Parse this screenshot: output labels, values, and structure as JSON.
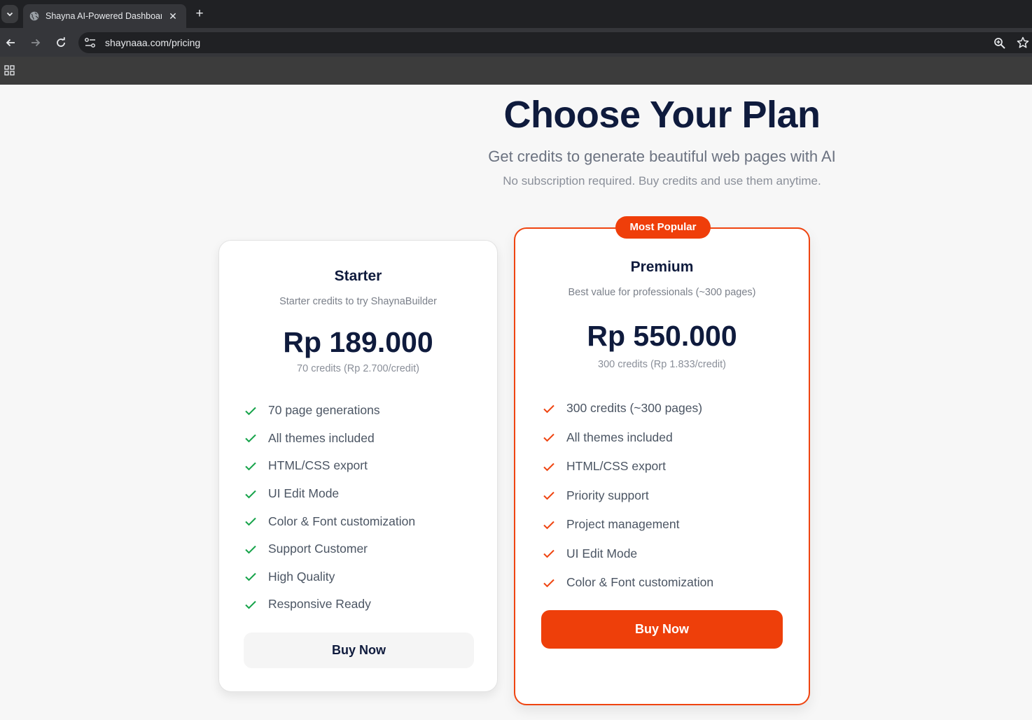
{
  "browser": {
    "tab_title": "Shayna AI-Powered Dashboard",
    "url": "shaynaaa.com/pricing",
    "icons": [
      "chevron-down-icon",
      "globe-icon",
      "close-icon",
      "plus-icon",
      "back-arrow-icon",
      "forward-arrow-icon",
      "reload-icon",
      "site-info-icon",
      "zoom-icon",
      "star-icon",
      "apps-icon"
    ]
  },
  "hero": {
    "title": "Choose Your Plan",
    "subtitle": "Get credits to generate beautiful web pages with AI",
    "note": "No subscription required. Buy credits and use them anytime."
  },
  "plans": [
    {
      "name": "Starter",
      "description": "Starter credits to try ShaynaBuilder",
      "price": "Rp 189.000",
      "unit": "70 credits (Rp 2.700/credit)",
      "features": [
        "70 page generations",
        "All themes included",
        "HTML/CSS export",
        "UI Edit Mode",
        "Color & Font customization",
        "Support Customer",
        "High Quality",
        "Responsive Ready"
      ],
      "button": "Buy Now",
      "check_color": "#16a34a"
    },
    {
      "badge": "Most Popular",
      "name": "Premium",
      "description": "Best value for professionals (~300 pages)",
      "price": "Rp 550.000",
      "unit": "300 credits (Rp 1.833/credit)",
      "features": [
        "300 credits (~300 pages)",
        "All themes included",
        "HTML/CSS export",
        "Priority support",
        "Project management",
        "UI Edit Mode",
        "Color & Font customization"
      ],
      "button": "Buy Now",
      "accent": "#ef4410"
    }
  ]
}
